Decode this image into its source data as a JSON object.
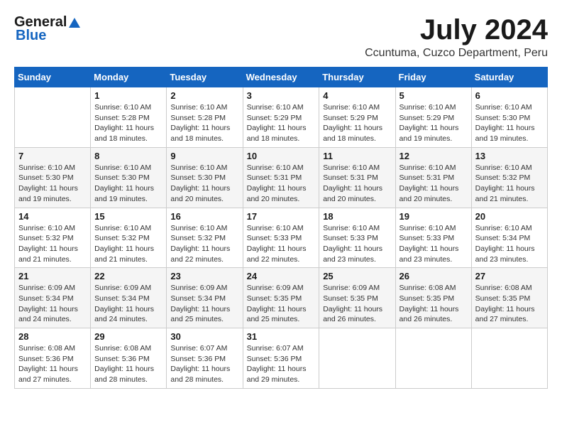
{
  "logo": {
    "general": "General",
    "blue": "Blue"
  },
  "title": "July 2024",
  "location": "Ccuntuma, Cuzco Department, Peru",
  "weekdays": [
    "Sunday",
    "Monday",
    "Tuesday",
    "Wednesday",
    "Thursday",
    "Friday",
    "Saturday"
  ],
  "weeks": [
    [
      {
        "day": "",
        "sunrise": "",
        "sunset": "",
        "daylight": ""
      },
      {
        "day": "1",
        "sunrise": "Sunrise: 6:10 AM",
        "sunset": "Sunset: 5:28 PM",
        "daylight": "Daylight: 11 hours and 18 minutes."
      },
      {
        "day": "2",
        "sunrise": "Sunrise: 6:10 AM",
        "sunset": "Sunset: 5:28 PM",
        "daylight": "Daylight: 11 hours and 18 minutes."
      },
      {
        "day": "3",
        "sunrise": "Sunrise: 6:10 AM",
        "sunset": "Sunset: 5:29 PM",
        "daylight": "Daylight: 11 hours and 18 minutes."
      },
      {
        "day": "4",
        "sunrise": "Sunrise: 6:10 AM",
        "sunset": "Sunset: 5:29 PM",
        "daylight": "Daylight: 11 hours and 18 minutes."
      },
      {
        "day": "5",
        "sunrise": "Sunrise: 6:10 AM",
        "sunset": "Sunset: 5:29 PM",
        "daylight": "Daylight: 11 hours and 19 minutes."
      },
      {
        "day": "6",
        "sunrise": "Sunrise: 6:10 AM",
        "sunset": "Sunset: 5:30 PM",
        "daylight": "Daylight: 11 hours and 19 minutes."
      }
    ],
    [
      {
        "day": "7",
        "sunrise": "Sunrise: 6:10 AM",
        "sunset": "Sunset: 5:30 PM",
        "daylight": "Daylight: 11 hours and 19 minutes."
      },
      {
        "day": "8",
        "sunrise": "Sunrise: 6:10 AM",
        "sunset": "Sunset: 5:30 PM",
        "daylight": "Daylight: 11 hours and 19 minutes."
      },
      {
        "day": "9",
        "sunrise": "Sunrise: 6:10 AM",
        "sunset": "Sunset: 5:30 PM",
        "daylight": "Daylight: 11 hours and 20 minutes."
      },
      {
        "day": "10",
        "sunrise": "Sunrise: 6:10 AM",
        "sunset": "Sunset: 5:31 PM",
        "daylight": "Daylight: 11 hours and 20 minutes."
      },
      {
        "day": "11",
        "sunrise": "Sunrise: 6:10 AM",
        "sunset": "Sunset: 5:31 PM",
        "daylight": "Daylight: 11 hours and 20 minutes."
      },
      {
        "day": "12",
        "sunrise": "Sunrise: 6:10 AM",
        "sunset": "Sunset: 5:31 PM",
        "daylight": "Daylight: 11 hours and 20 minutes."
      },
      {
        "day": "13",
        "sunrise": "Sunrise: 6:10 AM",
        "sunset": "Sunset: 5:32 PM",
        "daylight": "Daylight: 11 hours and 21 minutes."
      }
    ],
    [
      {
        "day": "14",
        "sunrise": "Sunrise: 6:10 AM",
        "sunset": "Sunset: 5:32 PM",
        "daylight": "Daylight: 11 hours and 21 minutes."
      },
      {
        "day": "15",
        "sunrise": "Sunrise: 6:10 AM",
        "sunset": "Sunset: 5:32 PM",
        "daylight": "Daylight: 11 hours and 21 minutes."
      },
      {
        "day": "16",
        "sunrise": "Sunrise: 6:10 AM",
        "sunset": "Sunset: 5:32 PM",
        "daylight": "Daylight: 11 hours and 22 minutes."
      },
      {
        "day": "17",
        "sunrise": "Sunrise: 6:10 AM",
        "sunset": "Sunset: 5:33 PM",
        "daylight": "Daylight: 11 hours and 22 minutes."
      },
      {
        "day": "18",
        "sunrise": "Sunrise: 6:10 AM",
        "sunset": "Sunset: 5:33 PM",
        "daylight": "Daylight: 11 hours and 23 minutes."
      },
      {
        "day": "19",
        "sunrise": "Sunrise: 6:10 AM",
        "sunset": "Sunset: 5:33 PM",
        "daylight": "Daylight: 11 hours and 23 minutes."
      },
      {
        "day": "20",
        "sunrise": "Sunrise: 6:10 AM",
        "sunset": "Sunset: 5:34 PM",
        "daylight": "Daylight: 11 hours and 23 minutes."
      }
    ],
    [
      {
        "day": "21",
        "sunrise": "Sunrise: 6:09 AM",
        "sunset": "Sunset: 5:34 PM",
        "daylight": "Daylight: 11 hours and 24 minutes."
      },
      {
        "day": "22",
        "sunrise": "Sunrise: 6:09 AM",
        "sunset": "Sunset: 5:34 PM",
        "daylight": "Daylight: 11 hours and 24 minutes."
      },
      {
        "day": "23",
        "sunrise": "Sunrise: 6:09 AM",
        "sunset": "Sunset: 5:34 PM",
        "daylight": "Daylight: 11 hours and 25 minutes."
      },
      {
        "day": "24",
        "sunrise": "Sunrise: 6:09 AM",
        "sunset": "Sunset: 5:35 PM",
        "daylight": "Daylight: 11 hours and 25 minutes."
      },
      {
        "day": "25",
        "sunrise": "Sunrise: 6:09 AM",
        "sunset": "Sunset: 5:35 PM",
        "daylight": "Daylight: 11 hours and 26 minutes."
      },
      {
        "day": "26",
        "sunrise": "Sunrise: 6:08 AM",
        "sunset": "Sunset: 5:35 PM",
        "daylight": "Daylight: 11 hours and 26 minutes."
      },
      {
        "day": "27",
        "sunrise": "Sunrise: 6:08 AM",
        "sunset": "Sunset: 5:35 PM",
        "daylight": "Daylight: 11 hours and 27 minutes."
      }
    ],
    [
      {
        "day": "28",
        "sunrise": "Sunrise: 6:08 AM",
        "sunset": "Sunset: 5:36 PM",
        "daylight": "Daylight: 11 hours and 27 minutes."
      },
      {
        "day": "29",
        "sunrise": "Sunrise: 6:08 AM",
        "sunset": "Sunset: 5:36 PM",
        "daylight": "Daylight: 11 hours and 28 minutes."
      },
      {
        "day": "30",
        "sunrise": "Sunrise: 6:07 AM",
        "sunset": "Sunset: 5:36 PM",
        "daylight": "Daylight: 11 hours and 28 minutes."
      },
      {
        "day": "31",
        "sunrise": "Sunrise: 6:07 AM",
        "sunset": "Sunset: 5:36 PM",
        "daylight": "Daylight: 11 hours and 29 minutes."
      },
      {
        "day": "",
        "sunrise": "",
        "sunset": "",
        "daylight": ""
      },
      {
        "day": "",
        "sunrise": "",
        "sunset": "",
        "daylight": ""
      },
      {
        "day": "",
        "sunrise": "",
        "sunset": "",
        "daylight": ""
      }
    ]
  ]
}
